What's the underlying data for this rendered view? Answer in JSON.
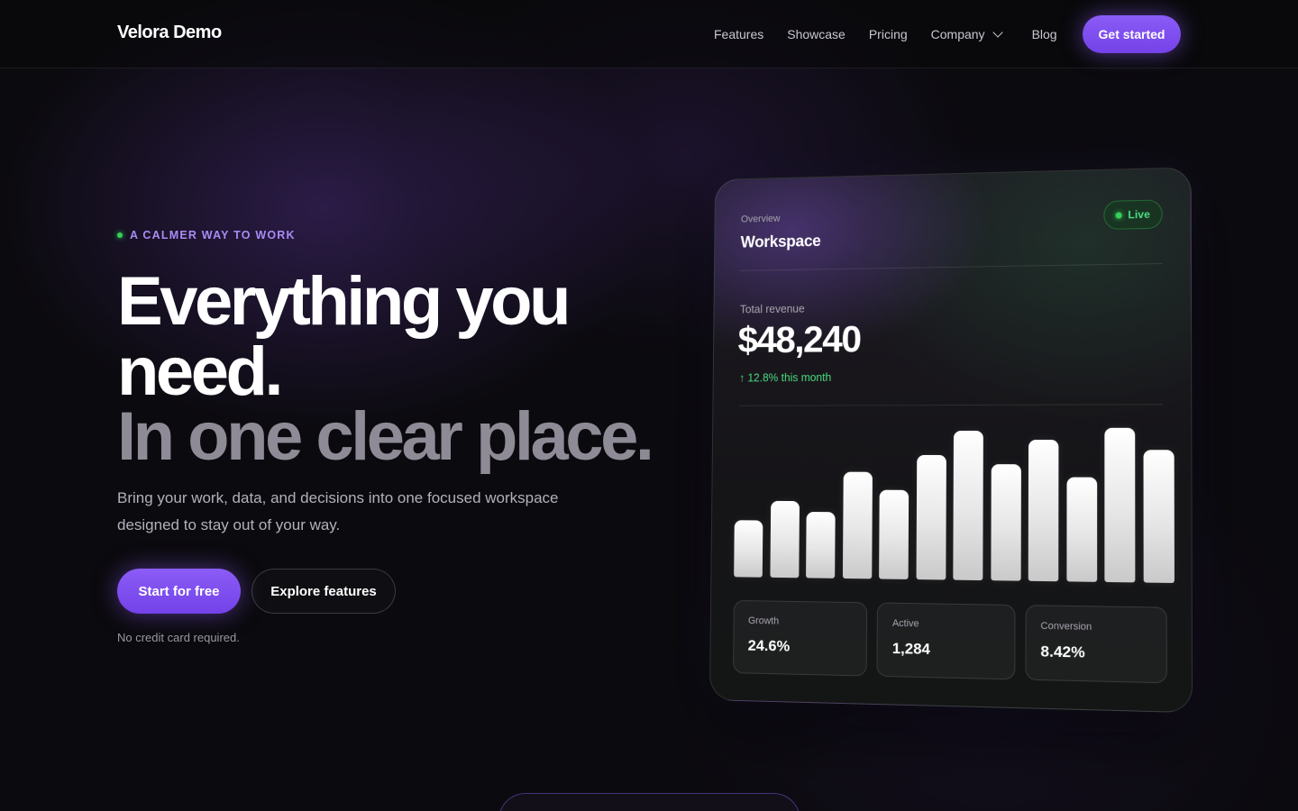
{
  "nav": {
    "brand": "Velora Demo",
    "links": [
      "Features",
      "Showcase",
      "Pricing",
      "Company",
      "Blog"
    ],
    "cta": "Get started"
  },
  "hero": {
    "eyebrow": "A CALMER WAY TO WORK",
    "headline_line1": "Everything you need.",
    "headline_line2": "In one clear place.",
    "subtext": "Bring your work, data, and decisions into one focused workspace designed to stay out of your way.",
    "primary_button": "Start for free",
    "secondary_button": "Explore features",
    "note": "No credit card required."
  },
  "card": {
    "overline": "Overview",
    "title": "Workspace",
    "badge": "Live",
    "revenue_label": "Total revenue",
    "revenue_value": "$48,240",
    "revenue_change": "↑ 12.8% this month",
    "bar_levels": [
      0.38,
      0.51,
      0.44,
      0.71,
      0.59,
      0.82,
      0.98,
      0.76,
      0.92,
      0.68,
      1.0,
      0.86
    ],
    "stats": [
      {
        "label": "Growth",
        "value": "24.6%"
      },
      {
        "label": "Active",
        "value": "1,284"
      },
      {
        "label": "Conversion",
        "value": "8.42%"
      }
    ]
  },
  "colors": {
    "accent": "#8b5cf6",
    "live_green": "#34d058",
    "background": "#0b0a0e"
  }
}
